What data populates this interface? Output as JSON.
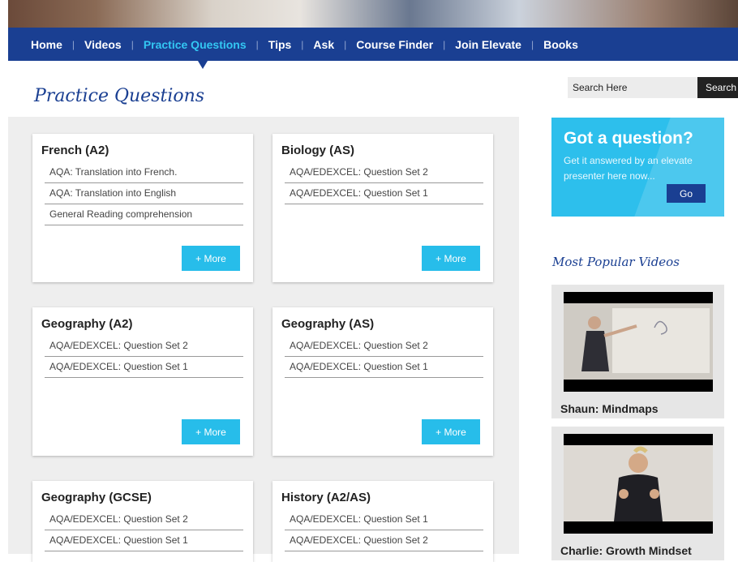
{
  "nav": {
    "items": [
      {
        "label": "Home"
      },
      {
        "label": "Videos"
      },
      {
        "label": "Practice Questions"
      },
      {
        "label": "Tips"
      },
      {
        "label": "Ask"
      },
      {
        "label": "Course Finder"
      },
      {
        "label": "Join Elevate"
      },
      {
        "label": "Books"
      }
    ],
    "separator": "|",
    "active": "Practice Questions"
  },
  "page_title": "Practice Questions",
  "search": {
    "placeholder": "Search Here",
    "button": "Search"
  },
  "cards": [
    {
      "title": "French (A2)",
      "items": [
        "AQA: Translation into French.",
        "AQA: Translation into English",
        "General Reading comprehension"
      ],
      "more": "+ More"
    },
    {
      "title": "Biology (AS)",
      "items": [
        "AQA/EDEXCEL: Question Set 2",
        "AQA/EDEXCEL: Question Set 1"
      ],
      "more": "+ More"
    },
    {
      "title": "Geography (A2)",
      "items": [
        "AQA/EDEXCEL: Question Set 2",
        "AQA/EDEXCEL: Question Set 1"
      ],
      "more": "+ More"
    },
    {
      "title": "Geography (AS)",
      "items": [
        "AQA/EDEXCEL: Question Set 2",
        "AQA/EDEXCEL: Question Set 1"
      ],
      "more": "+ More"
    },
    {
      "title": "Geography (GCSE)",
      "items": [
        "AQA/EDEXCEL: Question Set 2",
        "AQA/EDEXCEL: Question Set 1"
      ]
    },
    {
      "title": "History (A2/AS)",
      "items": [
        "AQA/EDEXCEL: Question Set 1",
        "AQA/EDEXCEL: Question Set 2"
      ]
    }
  ],
  "question_box": {
    "title": "Got a question?",
    "text": "Get it answered by an elevate presenter here now...",
    "button": "Go"
  },
  "popular": {
    "title": "Most Popular Videos",
    "videos": [
      {
        "caption": "Shaun: Mindmaps"
      },
      {
        "caption": "Charlie: Growth Mindset"
      }
    ]
  },
  "colors": {
    "nav_bg": "#1a3f92",
    "accent": "#27bdea",
    "active_link": "#33c7f3",
    "title": "#1a3f92"
  }
}
